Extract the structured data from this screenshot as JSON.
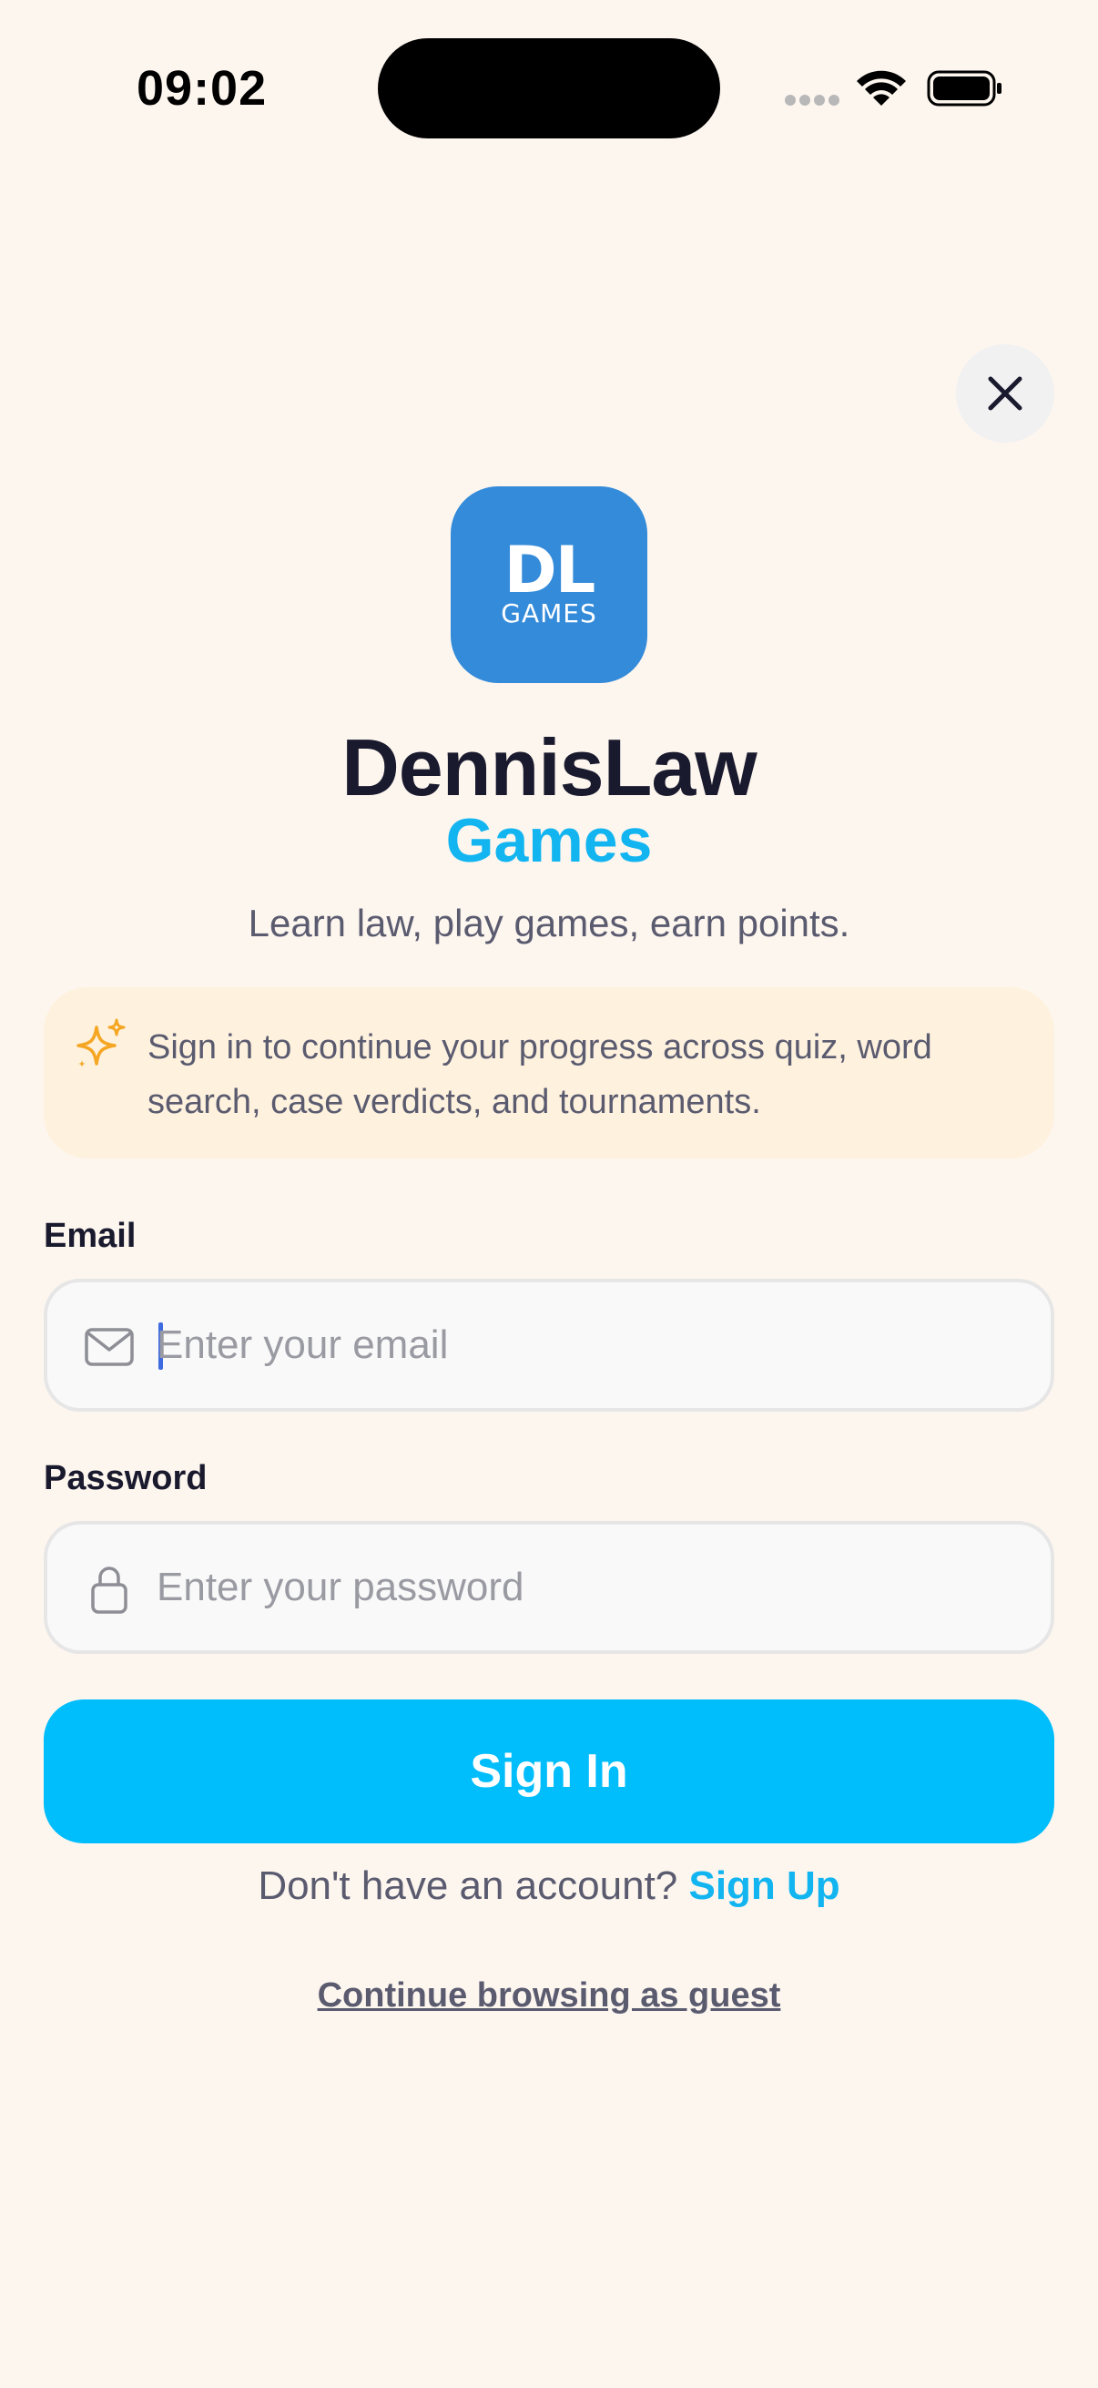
{
  "status_bar": {
    "time": "09:02"
  },
  "icons": {
    "close": "close-icon",
    "sparkle": "sparkle-icon",
    "email": "mail-icon",
    "password": "lock-icon"
  },
  "logo": {
    "line1": "DL",
    "line2": "GAMES"
  },
  "brand": {
    "title": "DennisLaw",
    "subtitle": "Games",
    "tagline": "Learn law, play games, earn points."
  },
  "info_banner": {
    "text": "Sign in to continue your progress across quiz, word search, case verdicts, and tournaments."
  },
  "form": {
    "email_label": "Email",
    "email_placeholder": "Enter your email",
    "email_value": "",
    "password_label": "Password",
    "password_placeholder": "Enter your password",
    "password_value": "",
    "submit_label": "Sign In"
  },
  "footer": {
    "signup_prompt": "Don't have an account?",
    "signup_link": "Sign Up",
    "guest_link": "Continue browsing as guest"
  },
  "colors": {
    "background": "#FDF6EF",
    "accent": "#00BDFC",
    "logo_bg": "#348BDA",
    "banner_bg": "#FEF2DE",
    "sparkle": "#F5A623"
  }
}
